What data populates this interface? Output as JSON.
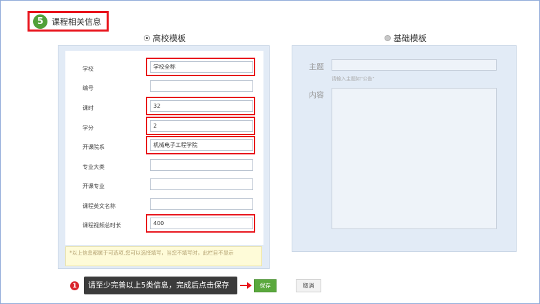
{
  "step": {
    "number": "5",
    "title": "课程相关信息"
  },
  "templates": {
    "school": {
      "label": "高校模板",
      "selected": true
    },
    "basic": {
      "label": "基础模板",
      "selected": false
    }
  },
  "form": {
    "fields": [
      {
        "label": "学校",
        "value": "学校全称",
        "highlighted": true
      },
      {
        "label": "编号",
        "value": "",
        "highlighted": false
      },
      {
        "label": "课时",
        "value": "32",
        "highlighted": true
      },
      {
        "label": "学分",
        "value": "2",
        "highlighted": true
      },
      {
        "label": "开课院系",
        "value": "机械电子工程学院",
        "highlighted": true
      },
      {
        "label": "专业大类",
        "value": "",
        "highlighted": false
      },
      {
        "label": "开课专业",
        "value": "",
        "highlighted": false
      },
      {
        "label": "课程英文名称",
        "value": "",
        "highlighted": false
      },
      {
        "label": "课程视频总时长",
        "value": "400",
        "highlighted": true
      }
    ],
    "note": "*以上信息都属于可选项,您可以选择填写，当您不填写时，此栏目不显示"
  },
  "basic_form": {
    "subject_label": "主题",
    "subject_hint": "请输入主题如\"公告\"",
    "content_label": "内容"
  },
  "actions": {
    "tip_number": "1",
    "tip_text": "请至少完善以上5类信息，完成后点击保存",
    "save_label": "保存",
    "cancel_label": "取消"
  },
  "colors": {
    "highlight": "#e8131b",
    "step_badge": "#52a13a",
    "save_button": "#5aa83d",
    "panel_bg": "#e2ebf6"
  }
}
